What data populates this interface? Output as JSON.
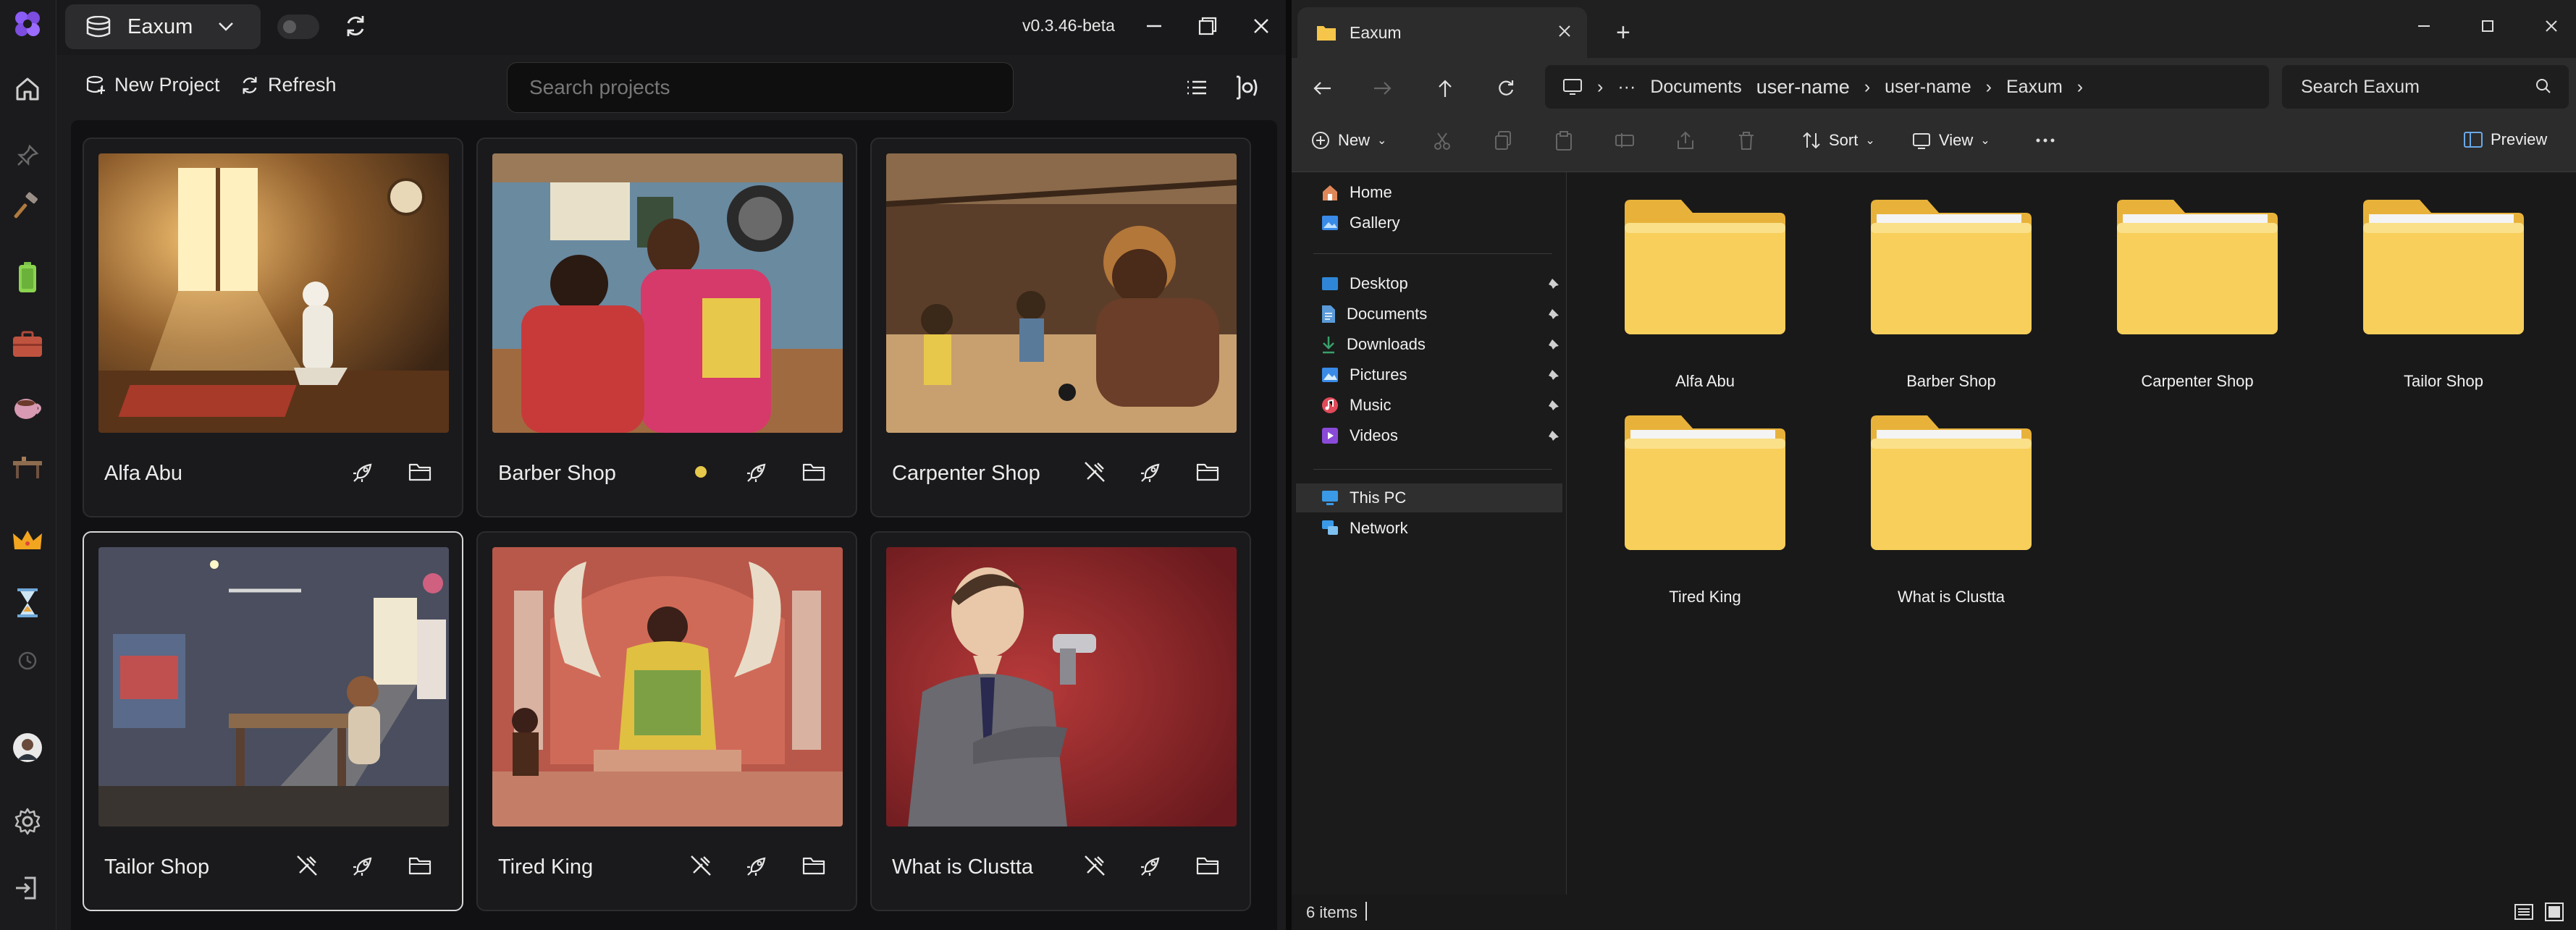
{
  "app": {
    "workspace": "Eaxum",
    "version": "v0.3.46-beta",
    "toolbar": {
      "new_project": "New Project",
      "refresh": "Refresh",
      "search_placeholder": "Search projects"
    },
    "projects": [
      {
        "name": "Alfa Abu",
        "actions": [
          "rocket-icon",
          "folder-icon"
        ]
      },
      {
        "name": "Barber Shop",
        "status_dot_color": "#e6c84a",
        "actions": [
          "rocket-icon",
          "folder-icon"
        ]
      },
      {
        "name": "Carpenter Shop",
        "actions": [
          "hammer-off-icon",
          "rocket-icon",
          "folder-icon"
        ]
      },
      {
        "name": "Tailor Shop",
        "selected": true,
        "actions": [
          "hammer-off-icon",
          "rocket-icon",
          "folder-icon"
        ]
      },
      {
        "name": "Tired King",
        "actions": [
          "hammer-off-icon",
          "rocket-icon",
          "folder-icon"
        ]
      },
      {
        "name": "What is Clustta",
        "actions": [
          "hammer-off-icon",
          "rocket-icon",
          "folder-icon"
        ]
      }
    ],
    "colors": {
      "accent": "#8b5cf6",
      "selected_border": "#d8d8d8",
      "dot": "#e6c84a"
    }
  },
  "explorer": {
    "tab_title": "Eaxum",
    "new_tab": "+",
    "breadcrumb": [
      "Documents",
      "user-name",
      "user-name",
      "Eaxum"
    ],
    "search_placeholder": "Search Eaxum",
    "commands": {
      "new": "New",
      "sort": "Sort",
      "view": "View",
      "preview": "Preview"
    },
    "nav": {
      "top": [
        "Home",
        "Gallery"
      ],
      "quick": [
        "Desktop",
        "Documents",
        "Downloads",
        "Pictures",
        "Music",
        "Videos"
      ],
      "bottom": [
        "This PC",
        "Network"
      ]
    },
    "folders": [
      "Alfa Abu",
      "Barber Shop",
      "Carpenter Shop",
      "Tailor Shop",
      "Tired King",
      "What is Clustta"
    ],
    "status": "6 items"
  }
}
